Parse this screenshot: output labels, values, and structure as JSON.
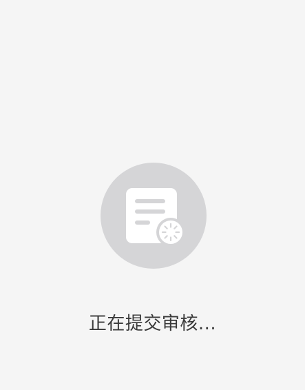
{
  "status": {
    "message": "正在提交审核..."
  },
  "illustration": {
    "icon": "document-loading-icon",
    "circle_color": "#d5d5d7",
    "document_color": "#ffffff",
    "line_color": "#d5d5d7"
  }
}
